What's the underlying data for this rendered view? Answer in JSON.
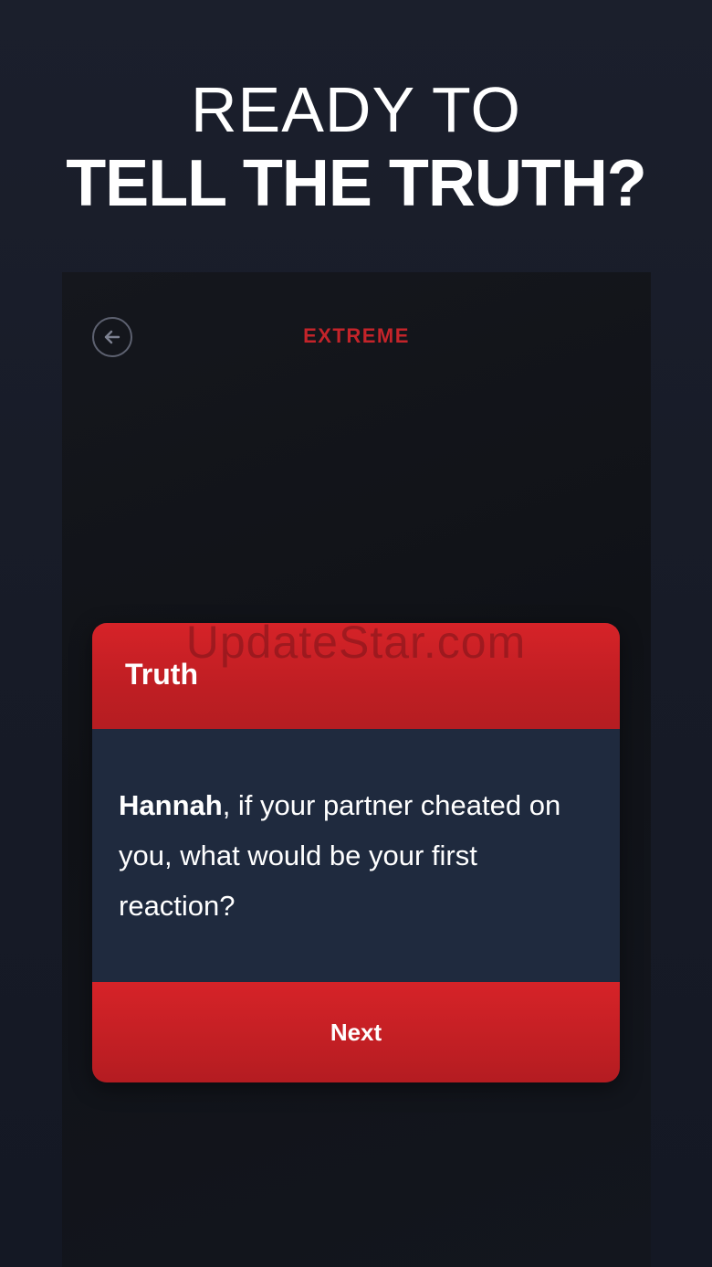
{
  "headline": {
    "line1": "READY TO",
    "line2": "TELL THE TRUTH?"
  },
  "screen": {
    "level": "EXTREME",
    "back_icon": "arrow-left-icon",
    "card": {
      "watermark": "UpdateStar.com",
      "title": "Truth",
      "question": {
        "player_name": "Hannah",
        "text": ", if your partner cheated on you, what would be your first reaction?"
      },
      "next_label": "Next"
    }
  },
  "colors": {
    "accent_red": "#d62328",
    "card_body": "#1f2a3e",
    "background": "#171b27"
  }
}
